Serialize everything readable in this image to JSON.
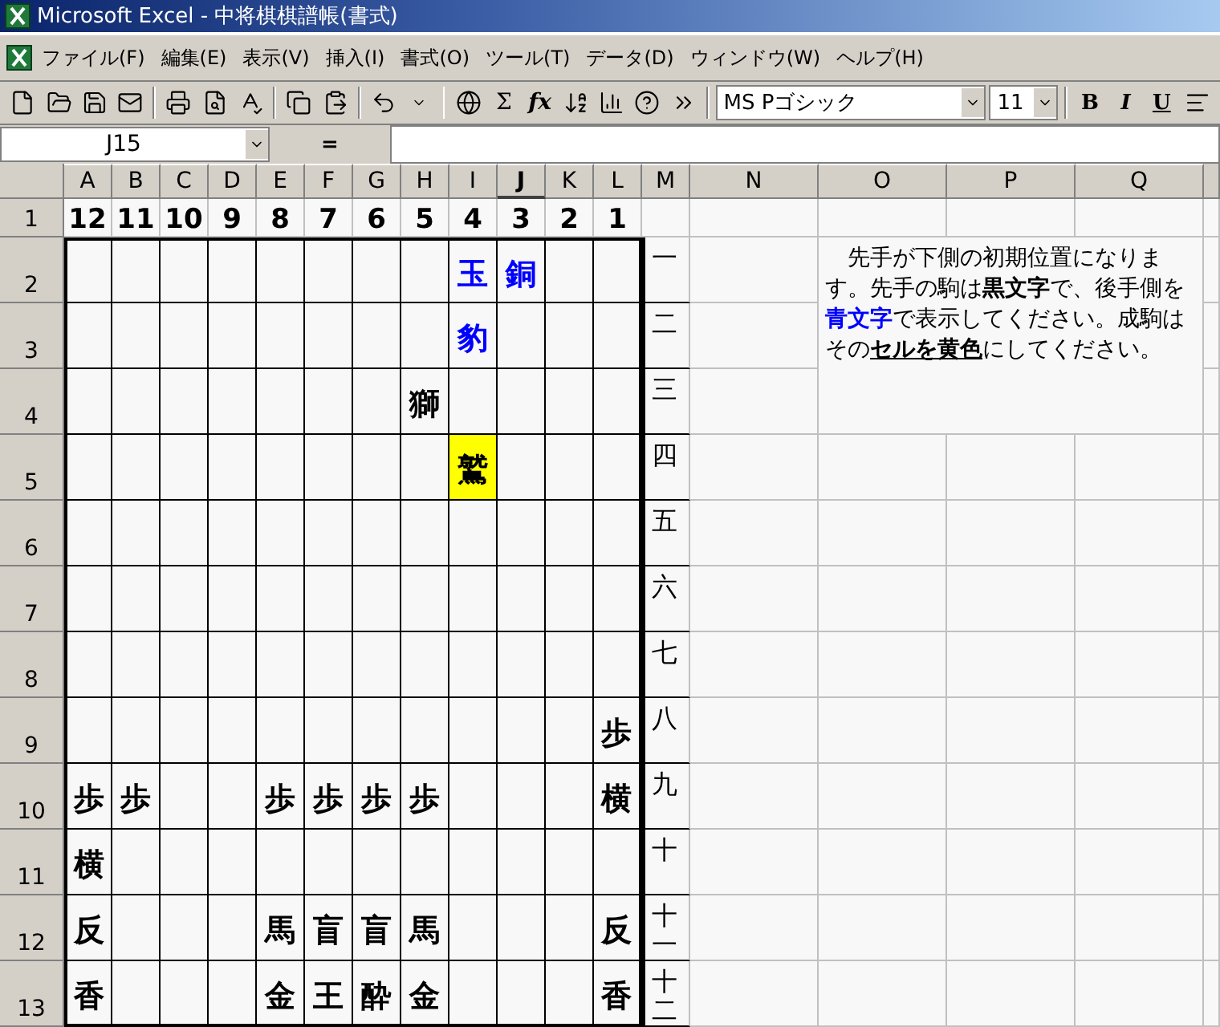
{
  "window": {
    "title": "Microsoft Excel - 中将棋棋譜帳(書式)"
  },
  "menu": [
    "ファイル(F)",
    "編集(E)",
    "表示(V)",
    "挿入(I)",
    "書式(O)",
    "ツール(T)",
    "データ(D)",
    "ウィンドウ(W)",
    "ヘルプ(H)"
  ],
  "toolbar": {
    "buttons": [
      {
        "kind": "new"
      },
      {
        "kind": "open"
      },
      {
        "kind": "save"
      },
      {
        "kind": "mail"
      },
      {
        "kind": "sep"
      },
      {
        "kind": "print"
      },
      {
        "kind": "preview"
      },
      {
        "kind": "spell"
      },
      {
        "kind": "sep"
      },
      {
        "kind": "copy"
      },
      {
        "kind": "paste"
      },
      {
        "kind": "sep"
      },
      {
        "kind": "undo"
      },
      {
        "kind": "caret"
      },
      {
        "kind": "sep"
      },
      {
        "kind": "web"
      },
      {
        "kind": "sum",
        "label": "Σ"
      },
      {
        "kind": "function",
        "label": "fx"
      },
      {
        "kind": "sort"
      },
      {
        "kind": "chart"
      },
      {
        "kind": "help"
      },
      {
        "kind": "more"
      }
    ],
    "font": "MS Pゴシック",
    "size": "11",
    "format_buttons": [
      {
        "kind": "bold",
        "label": "B"
      },
      {
        "kind": "italic",
        "label": "I"
      },
      {
        "kind": "underline",
        "label": "U"
      },
      {
        "kind": "align"
      }
    ]
  },
  "formula_bar": {
    "name_box": "J15",
    "equals": "="
  },
  "sheet": {
    "columns": [
      {
        "label": "A",
        "selected": false
      },
      {
        "label": "B",
        "selected": false
      },
      {
        "label": "C",
        "selected": false
      },
      {
        "label": "D",
        "selected": false
      },
      {
        "label": "E",
        "selected": false
      },
      {
        "label": "F",
        "selected": false
      },
      {
        "label": "G",
        "selected": false
      },
      {
        "label": "H",
        "selected": false
      },
      {
        "label": "I",
        "selected": false
      },
      {
        "label": "J",
        "selected": true
      },
      {
        "label": "K",
        "selected": false
      },
      {
        "label": "L",
        "selected": false
      },
      {
        "label": "M",
        "selected": false
      },
      {
        "label": "N",
        "selected": false
      },
      {
        "label": "O",
        "selected": false
      },
      {
        "label": "P",
        "selected": false
      },
      {
        "label": "Q",
        "selected": false
      }
    ],
    "row_numbers": [
      "1",
      "2",
      "3",
      "4",
      "5",
      "6",
      "7",
      "8",
      "9",
      "10",
      "11",
      "12",
      "13"
    ],
    "file_numbers": [
      "12",
      "11",
      "10",
      "9",
      "8",
      "7",
      "6",
      "5",
      "4",
      "3",
      "2",
      "1"
    ],
    "rank_labels": [
      "一",
      "二",
      "三",
      "四",
      "五",
      "六",
      "七",
      "八",
      "九",
      "十",
      "十一",
      "十二"
    ],
    "board": [
      [
        {
          "kind": "empty"
        },
        {
          "kind": "empty"
        },
        {
          "kind": "empty"
        },
        {
          "kind": "empty"
        },
        {
          "kind": "empty"
        },
        {
          "kind": "empty"
        },
        {
          "kind": "empty"
        },
        {
          "kind": "empty"
        },
        {
          "kind": "piece",
          "piece": "玉",
          "color": "#0000ff",
          "promoted": false
        },
        {
          "kind": "piece",
          "piece": "銅",
          "color": "#0000ff",
          "promoted": false
        },
        {
          "kind": "empty"
        },
        {
          "kind": "empty"
        }
      ],
      [
        {
          "kind": "empty"
        },
        {
          "kind": "empty"
        },
        {
          "kind": "empty"
        },
        {
          "kind": "empty"
        },
        {
          "kind": "empty"
        },
        {
          "kind": "empty"
        },
        {
          "kind": "empty"
        },
        {
          "kind": "empty"
        },
        {
          "kind": "piece",
          "piece": "豹",
          "color": "#0000ff",
          "promoted": false
        },
        {
          "kind": "empty"
        },
        {
          "kind": "empty"
        },
        {
          "kind": "empty"
        }
      ],
      [
        {
          "kind": "empty"
        },
        {
          "kind": "empty"
        },
        {
          "kind": "empty"
        },
        {
          "kind": "empty"
        },
        {
          "kind": "empty"
        },
        {
          "kind": "empty"
        },
        {
          "kind": "empty"
        },
        {
          "kind": "piece",
          "piece": "獅",
          "color": "#000000",
          "promoted": false
        },
        {
          "kind": "empty"
        },
        {
          "kind": "empty"
        },
        {
          "kind": "empty"
        },
        {
          "kind": "empty"
        }
      ],
      [
        {
          "kind": "empty"
        },
        {
          "kind": "empty"
        },
        {
          "kind": "empty"
        },
        {
          "kind": "empty"
        },
        {
          "kind": "empty"
        },
        {
          "kind": "empty"
        },
        {
          "kind": "empty"
        },
        {
          "kind": "empty"
        },
        {
          "kind": "piece",
          "piece": "鷲",
          "color": "#000000",
          "promoted": true
        },
        {
          "kind": "empty"
        },
        {
          "kind": "empty"
        },
        {
          "kind": "empty"
        }
      ],
      [
        {
          "kind": "empty"
        },
        {
          "kind": "empty"
        },
        {
          "kind": "empty"
        },
        {
          "kind": "empty"
        },
        {
          "kind": "empty"
        },
        {
          "kind": "empty"
        },
        {
          "kind": "empty"
        },
        {
          "kind": "empty"
        },
        {
          "kind": "empty"
        },
        {
          "kind": "empty"
        },
        {
          "kind": "empty"
        },
        {
          "kind": "empty"
        }
      ],
      [
        {
          "kind": "empty"
        },
        {
          "kind": "empty"
        },
        {
          "kind": "empty"
        },
        {
          "kind": "empty"
        },
        {
          "kind": "empty"
        },
        {
          "kind": "empty"
        },
        {
          "kind": "empty"
        },
        {
          "kind": "empty"
        },
        {
          "kind": "empty"
        },
        {
          "kind": "empty"
        },
        {
          "kind": "empty"
        },
        {
          "kind": "empty"
        }
      ],
      [
        {
          "kind": "empty"
        },
        {
          "kind": "empty"
        },
        {
          "kind": "empty"
        },
        {
          "kind": "empty"
        },
        {
          "kind": "empty"
        },
        {
          "kind": "empty"
        },
        {
          "kind": "empty"
        },
        {
          "kind": "empty"
        },
        {
          "kind": "empty"
        },
        {
          "kind": "empty"
        },
        {
          "kind": "empty"
        },
        {
          "kind": "empty"
        }
      ],
      [
        {
          "kind": "empty"
        },
        {
          "kind": "empty"
        },
        {
          "kind": "empty"
        },
        {
          "kind": "empty"
        },
        {
          "kind": "empty"
        },
        {
          "kind": "empty"
        },
        {
          "kind": "empty"
        },
        {
          "kind": "empty"
        },
        {
          "kind": "empty"
        },
        {
          "kind": "empty"
        },
        {
          "kind": "empty"
        },
        {
          "kind": "piece",
          "piece": "歩",
          "color": "#000000",
          "promoted": false
        }
      ],
      [
        {
          "kind": "piece",
          "piece": "歩",
          "color": "#000000",
          "promoted": false
        },
        {
          "kind": "piece",
          "piece": "歩",
          "color": "#000000",
          "promoted": false
        },
        {
          "kind": "empty"
        },
        {
          "kind": "empty"
        },
        {
          "kind": "piece",
          "piece": "歩",
          "color": "#000000",
          "promoted": false
        },
        {
          "kind": "piece",
          "piece": "歩",
          "color": "#000000",
          "promoted": false
        },
        {
          "kind": "piece",
          "piece": "歩",
          "color": "#000000",
          "promoted": false
        },
        {
          "kind": "piece",
          "piece": "歩",
          "color": "#000000",
          "promoted": false
        },
        {
          "kind": "empty"
        },
        {
          "kind": "empty"
        },
        {
          "kind": "empty"
        },
        {
          "kind": "piece",
          "piece": "横",
          "color": "#000000",
          "promoted": false
        }
      ],
      [
        {
          "kind": "piece",
          "piece": "横",
          "color": "#000000",
          "promoted": false
        },
        {
          "kind": "empty"
        },
        {
          "kind": "empty"
        },
        {
          "kind": "empty"
        },
        {
          "kind": "empty"
        },
        {
          "kind": "empty"
        },
        {
          "kind": "empty"
        },
        {
          "kind": "empty"
        },
        {
          "kind": "empty"
        },
        {
          "kind": "empty"
        },
        {
          "kind": "empty"
        },
        {
          "kind": "empty"
        }
      ],
      [
        {
          "kind": "piece",
          "piece": "反",
          "color": "#000000",
          "promoted": false
        },
        {
          "kind": "empty"
        },
        {
          "kind": "empty"
        },
        {
          "kind": "empty"
        },
        {
          "kind": "piece",
          "piece": "馬",
          "color": "#000000",
          "promoted": false
        },
        {
          "kind": "piece",
          "piece": "盲",
          "color": "#000000",
          "promoted": false
        },
        {
          "kind": "piece",
          "piece": "盲",
          "color": "#000000",
          "promoted": false
        },
        {
          "kind": "piece",
          "piece": "馬",
          "color": "#000000",
          "promoted": false
        },
        {
          "kind": "empty"
        },
        {
          "kind": "empty"
        },
        {
          "kind": "empty"
        },
        {
          "kind": "piece",
          "piece": "反",
          "color": "#000000",
          "promoted": false
        }
      ],
      [
        {
          "kind": "piece",
          "piece": "香",
          "color": "#000000",
          "promoted": false
        },
        {
          "kind": "empty"
        },
        {
          "kind": "empty"
        },
        {
          "kind": "empty"
        },
        {
          "kind": "piece",
          "piece": "金",
          "color": "#000000",
          "promoted": false
        },
        {
          "kind": "piece",
          "piece": "王",
          "color": "#000000",
          "promoted": false
        },
        {
          "kind": "piece",
          "piece": "酔",
          "color": "#000000",
          "promoted": false
        },
        {
          "kind": "piece",
          "piece": "金",
          "color": "#000000",
          "promoted": false
        },
        {
          "kind": "empty"
        },
        {
          "kind": "empty"
        },
        {
          "kind": "empty"
        },
        {
          "kind": "piece",
          "piece": "香",
          "color": "#000000",
          "promoted": false
        }
      ]
    ],
    "note": [
      {
        "kind": "plain",
        "text": "　先手が下側の初期位置になります。先手の駒は"
      },
      {
        "kind": "bold",
        "text": "黒文字"
      },
      {
        "kind": "plain",
        "text": "で、後手側を"
      },
      {
        "kind": "blue",
        "text": "青文字"
      },
      {
        "kind": "plain",
        "text": "で表示してください。成駒はその"
      },
      {
        "kind": "bold_underline",
        "text": "セルを黄色"
      },
      {
        "kind": "plain",
        "text": "にしてください。"
      }
    ]
  }
}
